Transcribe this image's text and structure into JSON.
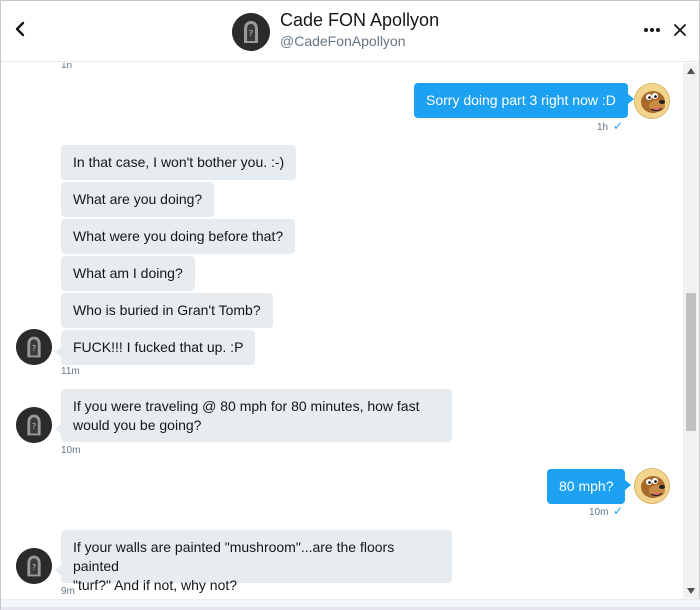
{
  "header": {
    "name": "Cade FON Apollyon",
    "handle": "@CadeFonApollyon",
    "back_icon": "chevron-left-icon",
    "more_icon": "more-horizontal-icon",
    "close_icon": "close-icon"
  },
  "colors": {
    "accent": "#1da1f2",
    "incoming_bubble": "#e6ecf0",
    "timestamp": "#657786"
  },
  "messages": [
    {
      "from": "them",
      "time": "1h"
    },
    {
      "from": "me",
      "text": "Sorry doing part 3 right now :D",
      "time": "1h",
      "read": true
    },
    {
      "from": "them",
      "text": "In that case, I won't bother you. :-)"
    },
    {
      "from": "them",
      "text": "What are you doing?"
    },
    {
      "from": "them",
      "text": "What were you doing before that?"
    },
    {
      "from": "them",
      "text": "What am I doing?"
    },
    {
      "from": "them",
      "text": "Who is buried in Gran't Tomb?"
    },
    {
      "from": "them",
      "text": "FUCK!!! I fucked that up. :P",
      "time": "11m"
    },
    {
      "from": "them",
      "text_line1": "If you were traveling @ 80 mph for 80 minutes, how fast",
      "text_line2": "would you be going?",
      "time": "10m"
    },
    {
      "from": "me",
      "text": "80 mph?",
      "time": "10m",
      "read": true
    },
    {
      "from": "them",
      "text_line1": "If your walls are painted \"mushroom\"...are the floors painted",
      "text_line2": "\"turf?\" And if not, why not?",
      "time": "9m"
    }
  ],
  "read_mark": "✓"
}
